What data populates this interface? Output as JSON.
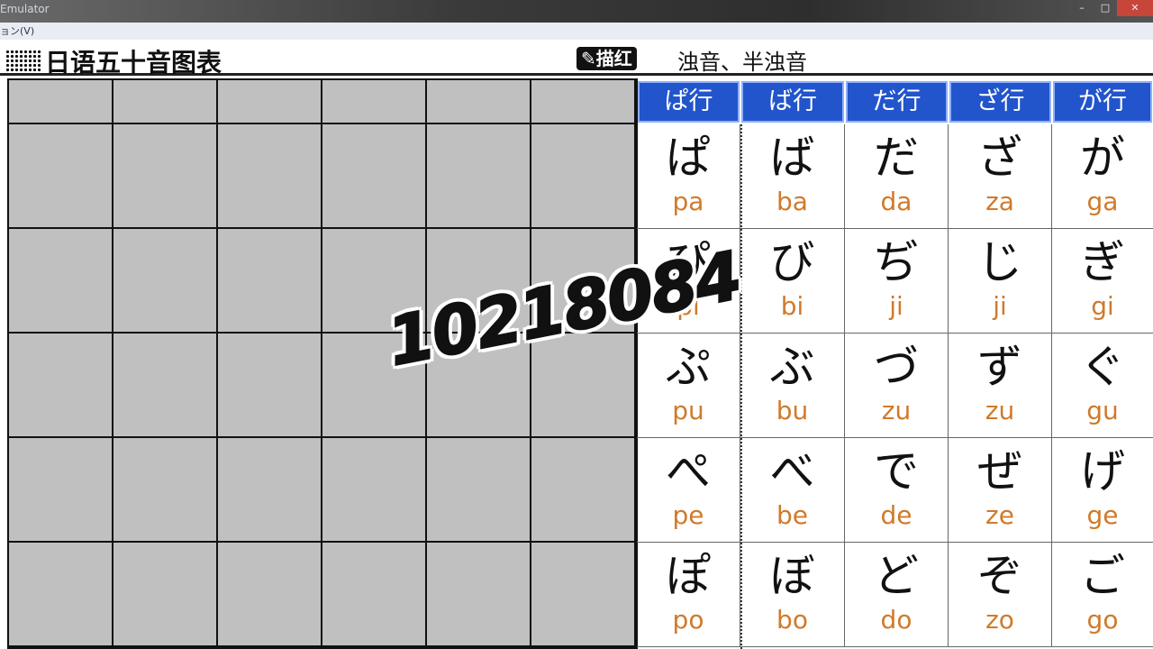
{
  "window": {
    "title": "Emulator",
    "menu": "ョン(V)"
  },
  "header": {
    "title": "日语五十音图表",
    "trace_button": "✎描红",
    "mode": "浊音、半浊音"
  },
  "columns": [
    {
      "header": "ぱ行",
      "cells": [
        {
          "kana": "ぱ",
          "romaji": "pa"
        },
        {
          "kana": "ぴ",
          "romaji": "pi"
        },
        {
          "kana": "ぷ",
          "romaji": "pu"
        },
        {
          "kana": "ぺ",
          "romaji": "pe"
        },
        {
          "kana": "ぽ",
          "romaji": "po"
        }
      ]
    },
    {
      "header": "ば行",
      "cells": [
        {
          "kana": "ば",
          "romaji": "ba"
        },
        {
          "kana": "び",
          "romaji": "bi"
        },
        {
          "kana": "ぶ",
          "romaji": "bu"
        },
        {
          "kana": "べ",
          "romaji": "be"
        },
        {
          "kana": "ぼ",
          "romaji": "bo"
        }
      ]
    },
    {
      "header": "だ行",
      "cells": [
        {
          "kana": "だ",
          "romaji": "da"
        },
        {
          "kana": "ぢ",
          "romaji": "ji"
        },
        {
          "kana": "づ",
          "romaji": "zu"
        },
        {
          "kana": "で",
          "romaji": "de"
        },
        {
          "kana": "ど",
          "romaji": "do"
        }
      ]
    },
    {
      "header": "ざ行",
      "cells": [
        {
          "kana": "ざ",
          "romaji": "za"
        },
        {
          "kana": "じ",
          "romaji": "ji"
        },
        {
          "kana": "ず",
          "romaji": "zu"
        },
        {
          "kana": "ぜ",
          "romaji": "ze"
        },
        {
          "kana": "ぞ",
          "romaji": "zo"
        }
      ]
    },
    {
      "header": "が行",
      "cells": [
        {
          "kana": "が",
          "romaji": "ga"
        },
        {
          "kana": "ぎ",
          "romaji": "gi"
        },
        {
          "kana": "ぐ",
          "romaji": "gu"
        },
        {
          "kana": "げ",
          "romaji": "ge"
        },
        {
          "kana": "ご",
          "romaji": "go"
        }
      ]
    }
  ],
  "watermark": "10218084",
  "colors": {
    "header_blue": "#2255cc",
    "romaji": "#d07a2a",
    "grid_gray": "#c0c0c0"
  }
}
